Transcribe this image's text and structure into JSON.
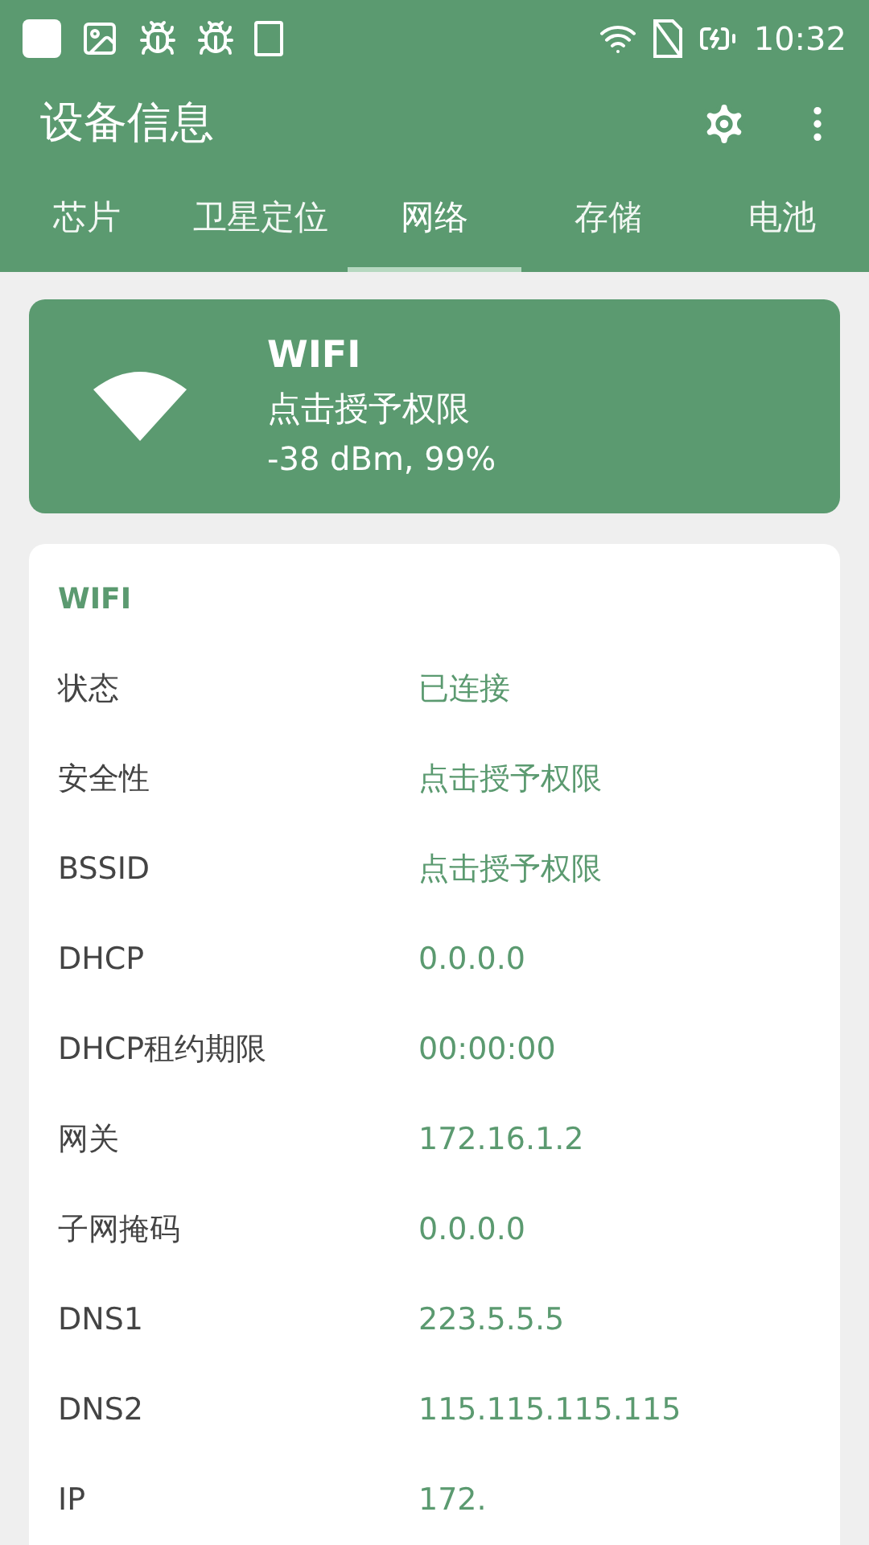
{
  "status_bar": {
    "time": "10:32"
  },
  "app_bar": {
    "title": "设备信息"
  },
  "tabs": [
    {
      "label": "芯片",
      "selected": false
    },
    {
      "label": "卫星定位",
      "selected": false
    },
    {
      "label": "网络",
      "selected": true
    },
    {
      "label": "存储",
      "selected": false
    },
    {
      "label": "电池",
      "selected": false
    }
  ],
  "summary_card": {
    "title": "WIFI",
    "subtitle": "点击授予权限",
    "reading": "-38 dBm, 99%"
  },
  "details": {
    "heading": "WIFI",
    "rows": [
      {
        "label": "状态",
        "value": "已连接"
      },
      {
        "label": "安全性",
        "value": "点击授予权限"
      },
      {
        "label": "BSSID",
        "value": "点击授予权限"
      },
      {
        "label": "DHCP",
        "value": "0.0.0.0"
      },
      {
        "label": "DHCP租约期限",
        "value": "00:00:00"
      },
      {
        "label": "网关",
        "value": "172.16.1.2"
      },
      {
        "label": "子网掩码",
        "value": "0.0.0.0"
      },
      {
        "label": "DNS1",
        "value": "223.5.5.5"
      },
      {
        "label": "DNS2",
        "value": "115.115.115.115"
      },
      {
        "label": "IP",
        "value": "172."
      }
    ]
  }
}
